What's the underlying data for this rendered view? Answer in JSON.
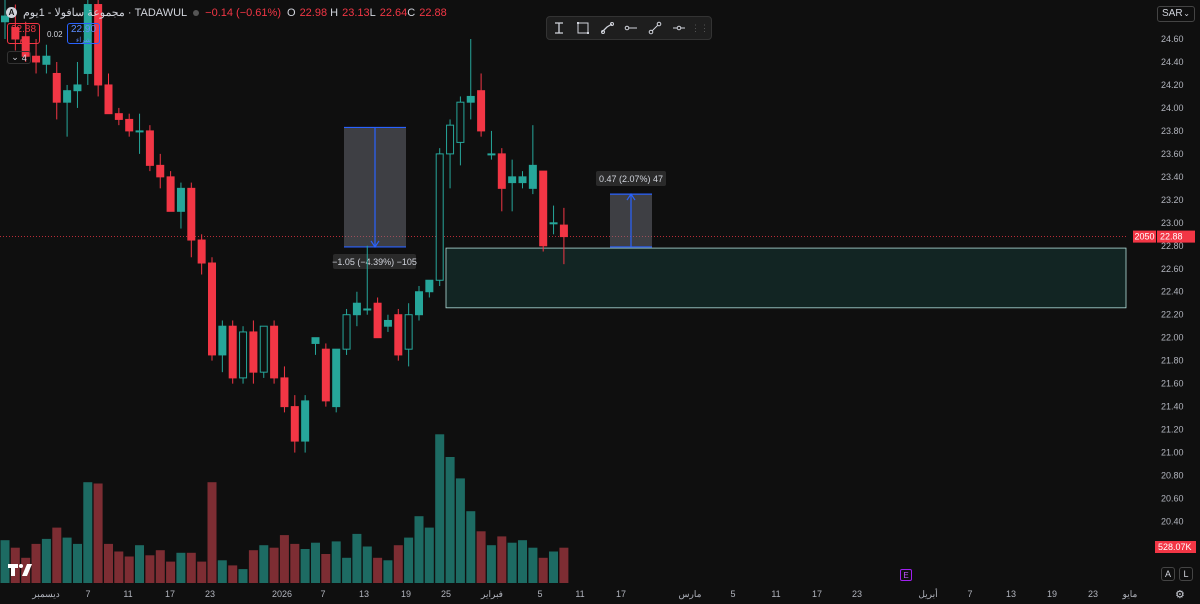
{
  "legend": {
    "symbol_initial": "A",
    "title": "مجموعة سافولا - 1يوم · TADAWUL",
    "change": "−0.14 (−0.61%)",
    "ohlc": [
      {
        "k": "O",
        "v": "22.98"
      },
      {
        "k": "H",
        "v": "23.13"
      },
      {
        "k": "L",
        "v": "22.64"
      },
      {
        "k": "C",
        "v": "22.88"
      }
    ]
  },
  "trade": {
    "sell_price": "22.88",
    "sell_label": "بيع",
    "buy_price": "22.90",
    "buy_label": "شراء",
    "spread": "0.02"
  },
  "collapse": {
    "count": "4"
  },
  "toolbar": {
    "icons": [
      "text-cursor-icon",
      "rectangle-icon",
      "brush-icon",
      "horizontal-ray-icon",
      "trend-line-icon",
      "horizontal-line-icon"
    ]
  },
  "currency": {
    "label": "SAR"
  },
  "price_axis": {
    "ticks": [
      "24.60",
      "24.40",
      "24.20",
      "24.00",
      "23.80",
      "23.60",
      "23.40",
      "23.20",
      "23.00",
      "22.80",
      "22.60",
      "22.40",
      "22.20",
      "22.00",
      "21.80",
      "21.60",
      "21.40",
      "21.20",
      "21.00",
      "20.80",
      "20.60",
      "20.40"
    ],
    "current_price": "22.88",
    "countdown": "2050",
    "volume_label": "528.07K"
  },
  "time_axis": {
    "labels": [
      "ديسمبر",
      "7",
      "11",
      "17",
      "23",
      "2026",
      "7",
      "13",
      "19",
      "25",
      "فبراير",
      "5",
      "11",
      "17",
      "مارس",
      "5",
      "11",
      "17",
      "23",
      "أبريل",
      "7",
      "13",
      "19",
      "23",
      "مايو"
    ]
  },
  "measure_down": "−1.05 (−4.39%) −105",
  "measure_up": "0.47 (2.07%) 47",
  "axis_buttons": {
    "auto": "A",
    "log": "L"
  },
  "earnings_label": "E",
  "colors": {
    "up": "#26a69a",
    "down": "#f23645",
    "volume_up": "#1d6b63",
    "volume_down": "#7d2d33",
    "accent": "#2962ff"
  },
  "chart_data": {
    "type": "candlestick",
    "ylim": [
      20.3,
      24.7
    ],
    "candles": [
      {
        "o": 24.75,
        "h": 24.95,
        "l": 24.6,
        "c": 24.8
      },
      {
        "o": 24.7,
        "h": 24.9,
        "l": 24.5,
        "c": 24.6
      },
      {
        "o": 24.62,
        "h": 24.75,
        "l": 24.4,
        "c": 24.45
      },
      {
        "o": 24.45,
        "h": 24.6,
        "l": 24.3,
        "c": 24.4
      },
      {
        "o": 24.38,
        "h": 24.55,
        "l": 24.3,
        "c": 24.45
      },
      {
        "o": 24.3,
        "h": 24.4,
        "l": 23.9,
        "c": 24.05
      },
      {
        "o": 24.05,
        "h": 24.2,
        "l": 23.75,
        "c": 24.15
      },
      {
        "o": 24.15,
        "h": 24.4,
        "l": 24.0,
        "c": 24.2
      },
      {
        "o": 24.3,
        "h": 25.0,
        "l": 24.2,
        "c": 24.9
      },
      {
        "o": 24.9,
        "h": 25.0,
        "l": 24.1,
        "c": 24.2
      },
      {
        "o": 24.2,
        "h": 24.3,
        "l": 23.95,
        "c": 23.95
      },
      {
        "o": 23.95,
        "h": 24.0,
        "l": 23.85,
        "c": 23.9
      },
      {
        "o": 23.9,
        "h": 23.95,
        "l": 23.75,
        "c": 23.8
      },
      {
        "o": 23.8,
        "h": 23.95,
        "l": 23.6,
        "c": 23.8
      },
      {
        "o": 23.8,
        "h": 23.85,
        "l": 23.45,
        "c": 23.5
      },
      {
        "o": 23.5,
        "h": 23.6,
        "l": 23.3,
        "c": 23.4
      },
      {
        "o": 23.4,
        "h": 23.45,
        "l": 23.1,
        "c": 23.1
      },
      {
        "o": 23.1,
        "h": 23.35,
        "l": 22.95,
        "c": 23.3
      },
      {
        "o": 23.3,
        "h": 23.35,
        "l": 22.7,
        "c": 22.85
      },
      {
        "o": 22.85,
        "h": 22.9,
        "l": 22.55,
        "c": 22.65
      },
      {
        "o": 22.65,
        "h": 22.7,
        "l": 21.8,
        "c": 21.85
      },
      {
        "o": 21.85,
        "h": 22.15,
        "l": 21.7,
        "c": 22.1
      },
      {
        "o": 22.1,
        "h": 22.15,
        "l": 21.6,
        "c": 21.65
      },
      {
        "o": 21.65,
        "h": 22.1,
        "l": 21.6,
        "c": 22.05
      },
      {
        "o": 22.05,
        "h": 22.15,
        "l": 21.6,
        "c": 21.7
      },
      {
        "o": 21.7,
        "h": 22.1,
        "l": 21.65,
        "c": 22.1
      },
      {
        "o": 22.1,
        "h": 22.15,
        "l": 21.6,
        "c": 21.65
      },
      {
        "o": 21.65,
        "h": 21.75,
        "l": 21.35,
        "c": 21.4
      },
      {
        "o": 21.4,
        "h": 21.5,
        "l": 21.0,
        "c": 21.1
      },
      {
        "o": 21.1,
        "h": 21.5,
        "l": 21.0,
        "c": 21.45
      },
      {
        "o": 21.95,
        "h": 22.0,
        "l": 21.85,
        "c": 22.0
      },
      {
        "o": 21.9,
        "h": 21.95,
        "l": 21.4,
        "c": 21.45
      },
      {
        "o": 21.4,
        "h": 21.9,
        "l": 21.35,
        "c": 21.9
      },
      {
        "o": 21.9,
        "h": 22.25,
        "l": 21.85,
        "c": 22.2
      },
      {
        "o": 22.2,
        "h": 22.4,
        "l": 22.1,
        "c": 22.3
      },
      {
        "o": 22.25,
        "h": 22.8,
        "l": 22.2,
        "c": 22.25
      },
      {
        "o": 22.3,
        "h": 22.35,
        "l": 22.0,
        "c": 22.0
      },
      {
        "o": 22.1,
        "h": 22.2,
        "l": 22.05,
        "c": 22.15
      },
      {
        "o": 22.2,
        "h": 22.25,
        "l": 21.8,
        "c": 21.85
      },
      {
        "o": 21.9,
        "h": 22.3,
        "l": 21.75,
        "c": 22.2
      },
      {
        "o": 22.2,
        "h": 22.45,
        "l": 22.15,
        "c": 22.4
      },
      {
        "o": 22.4,
        "h": 22.5,
        "l": 22.35,
        "c": 22.5
      },
      {
        "o": 22.5,
        "h": 23.65,
        "l": 22.45,
        "c": 23.6
      },
      {
        "o": 23.6,
        "h": 23.9,
        "l": 23.3,
        "c": 23.85
      },
      {
        "o": 23.7,
        "h": 24.1,
        "l": 23.5,
        "c": 24.05
      },
      {
        "o": 24.05,
        "h": 24.6,
        "l": 23.9,
        "c": 24.1
      },
      {
        "o": 24.15,
        "h": 24.3,
        "l": 23.75,
        "c": 23.8
      },
      {
        "o": 23.6,
        "h": 23.8,
        "l": 23.55,
        "c": 23.6
      },
      {
        "o": 23.6,
        "h": 23.65,
        "l": 23.1,
        "c": 23.3
      },
      {
        "o": 23.35,
        "h": 23.55,
        "l": 23.1,
        "c": 23.4
      },
      {
        "o": 23.35,
        "h": 23.45,
        "l": 23.3,
        "c": 23.4
      },
      {
        "o": 23.3,
        "h": 23.85,
        "l": 23.25,
        "c": 23.5
      },
      {
        "o": 23.45,
        "h": 23.45,
        "l": 22.75,
        "c": 22.8
      },
      {
        "o": 23.0,
        "h": 23.15,
        "l": 22.9,
        "c": 23.0
      },
      {
        "o": 22.98,
        "h": 23.13,
        "l": 22.64,
        "c": 22.88
      }
    ],
    "volume": [
      0.34,
      0.28,
      0.2,
      0.31,
      0.35,
      0.44,
      0.36,
      0.31,
      0.8,
      0.79,
      0.31,
      0.25,
      0.21,
      0.3,
      0.22,
      0.26,
      0.17,
      0.24,
      0.24,
      0.17,
      0.8,
      0.18,
      0.14,
      0.11,
      0.26,
      0.3,
      0.28,
      0.38,
      0.31,
      0.27,
      0.32,
      0.23,
      0.33,
      0.2,
      0.39,
      0.29,
      0.2,
      0.18,
      0.3,
      0.36,
      0.53,
      0.44,
      1.18,
      1.0,
      0.83,
      0.57,
      0.41,
      0.3,
      0.37,
      0.32,
      0.34,
      0.28,
      0.2,
      0.25,
      0.28
    ],
    "zones": [
      {
        "type": "rectangle",
        "from": 22.26,
        "to": 22.78
      }
    ],
    "measures": [
      {
        "from": 23.83,
        "to": 22.79,
        "label": "−1.05 (−4.39%) −105"
      },
      {
        "from": 22.79,
        "to": 23.25,
        "label": "0.47 (2.07%) 47"
      }
    ],
    "last_price": 22.88
  }
}
